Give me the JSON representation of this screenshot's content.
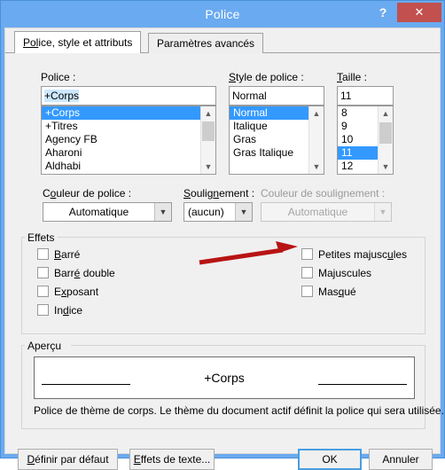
{
  "window": {
    "title": "Police",
    "help_label": "?",
    "close_label": "✕"
  },
  "tabs": [
    {
      "label": "Police, style et attributs",
      "active": true
    },
    {
      "label": "Paramètres avancés",
      "active": false
    }
  ],
  "font": {
    "label": "Police :",
    "value": "+Corps",
    "items": [
      "+Corps",
      "+Titres",
      "Agency FB",
      "Aharoni",
      "Aldhabi"
    ],
    "selected": "+Corps"
  },
  "style": {
    "label": "Style de police :",
    "value": "Normal",
    "items": [
      "Normal",
      "Italique",
      "Gras",
      "Gras Italique"
    ],
    "selected": "Normal"
  },
  "size": {
    "label": "Taille :",
    "value": "11",
    "items": [
      "8",
      "9",
      "10",
      "11",
      "12"
    ],
    "selected": "11"
  },
  "font_color": {
    "label": "Couleur de police :",
    "value": "Automatique",
    "disabled": false
  },
  "underline_style": {
    "label": "Soulignement :",
    "value": "(aucun)",
    "disabled": false
  },
  "underline_color": {
    "label": "Couleur de soulignement :",
    "value": "Automatique",
    "disabled": true
  },
  "effects": {
    "title": "Effets",
    "left": [
      {
        "label": "Barré",
        "checked": false
      },
      {
        "label": "Barré double",
        "checked": false
      },
      {
        "label": "Exposant",
        "checked": false
      },
      {
        "label": "Indice",
        "checked": false
      }
    ],
    "right": [
      {
        "label": "Petites majuscules",
        "checked": false
      },
      {
        "label": "Majuscules",
        "checked": false
      },
      {
        "label": "Masqué",
        "checked": false
      }
    ]
  },
  "preview": {
    "title": "Aperçu",
    "sample_text": "+Corps",
    "description": "Police de thème de corps. Le thème du document actif définit la police qui sera utilisée."
  },
  "buttons": {
    "set_default": "Définir par défaut",
    "text_effects": "Effets de texte...",
    "ok": "OK",
    "cancel": "Annuler"
  },
  "annotation": {
    "arrow_color": "#b81414",
    "points_to": "Petites majuscules"
  },
  "colors": {
    "titlebar": "#6aaaf0",
    "close_button": "#c1504e",
    "selection": "#3399ff",
    "default_button_border": "#4a9ee0"
  }
}
